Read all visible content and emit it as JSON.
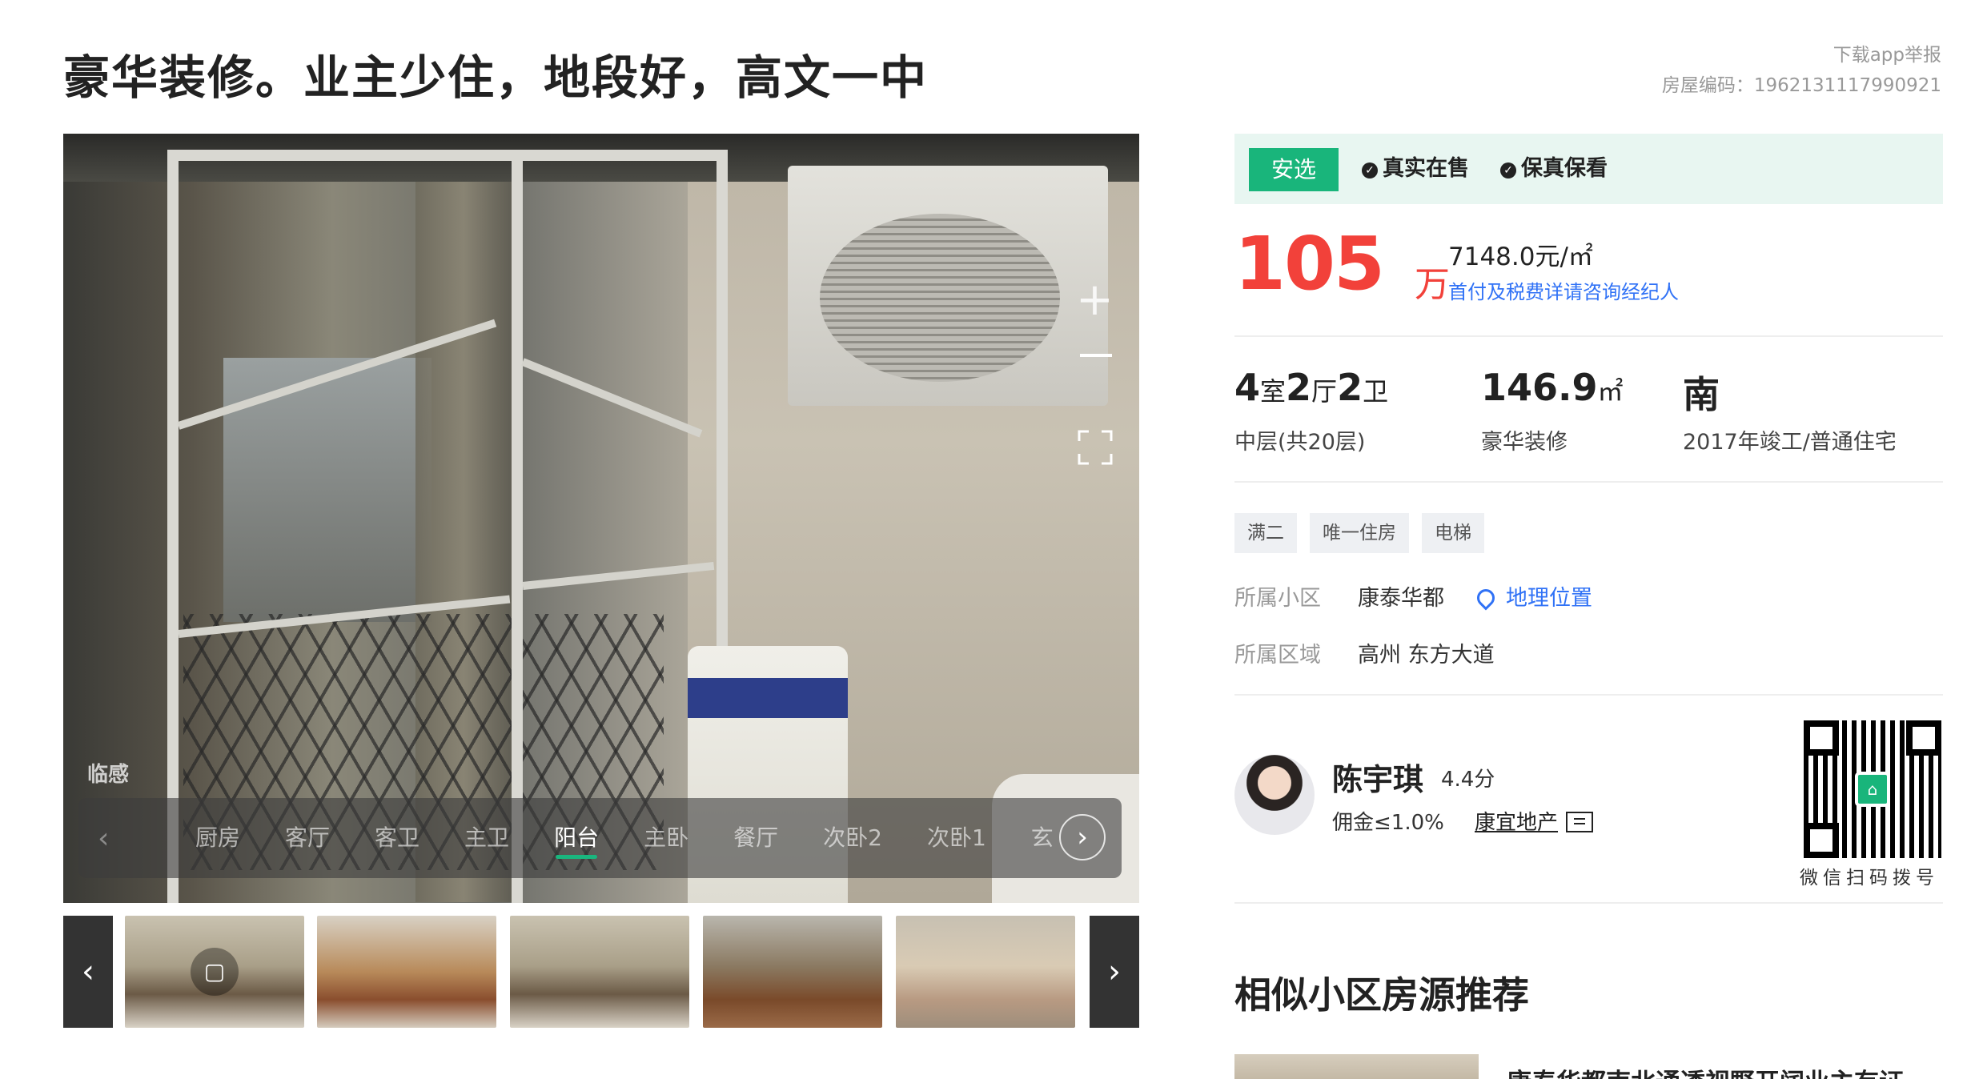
{
  "listing": {
    "title": "豪华装修。业主少住，地段好，高文一中",
    "report_link": "下载app举报",
    "house_code": "房屋编码：1962131117990921"
  },
  "viewer": {
    "watermark": "临感",
    "zoom_in": "+",
    "room_tabs": [
      "厨房",
      "客厅",
      "客卫",
      "主卫",
      "阳台",
      "主卧",
      "餐厅",
      "次卧2",
      "次卧1",
      "玄"
    ],
    "active_room": "阳台",
    "prev_arrow": "‹",
    "next_arrow": "›"
  },
  "thumbnails": {
    "prev": "‹",
    "next": "›",
    "count": 5
  },
  "panel": {
    "badge": "安选",
    "guarantees": [
      "真实在售",
      "保真保看"
    ],
    "price": "105",
    "price_unit": "万",
    "unit_price": "7148.0元/㎡",
    "tax_link": "首付及税费详请咨询经纪人",
    "layout": {
      "rooms_num1": "4",
      "rooms_lbl1": "室",
      "rooms_num2": "2",
      "rooms_lbl2": "厅",
      "rooms_num3": "2",
      "rooms_lbl3": "卫",
      "area_num": "146.9",
      "area_unit": "㎡",
      "orientation": "南"
    },
    "layout_sub": {
      "floor": "中层(共20层)",
      "decoration": "豪华装修",
      "year_type": "2017年竣工/普通住宅"
    },
    "tags": [
      "满二",
      "唯一住房",
      "电梯"
    ],
    "community_label": "所属小区",
    "community_value": "康泰华都",
    "geo_link": "地理位置",
    "region_label": "所属区域",
    "region_value": "高州 东方大道"
  },
  "agent": {
    "name": "陈宇琪",
    "score": "4.4分",
    "commission": "佣金≤1.0%",
    "agency": "康宜地产",
    "qr_label": "微信扫码拨号",
    "qr_logo": "⌂"
  },
  "recommend": {
    "section_title": "相似小区房源推荐",
    "first_title": "康泰华都南北通透视野开阔业主有证..."
  }
}
